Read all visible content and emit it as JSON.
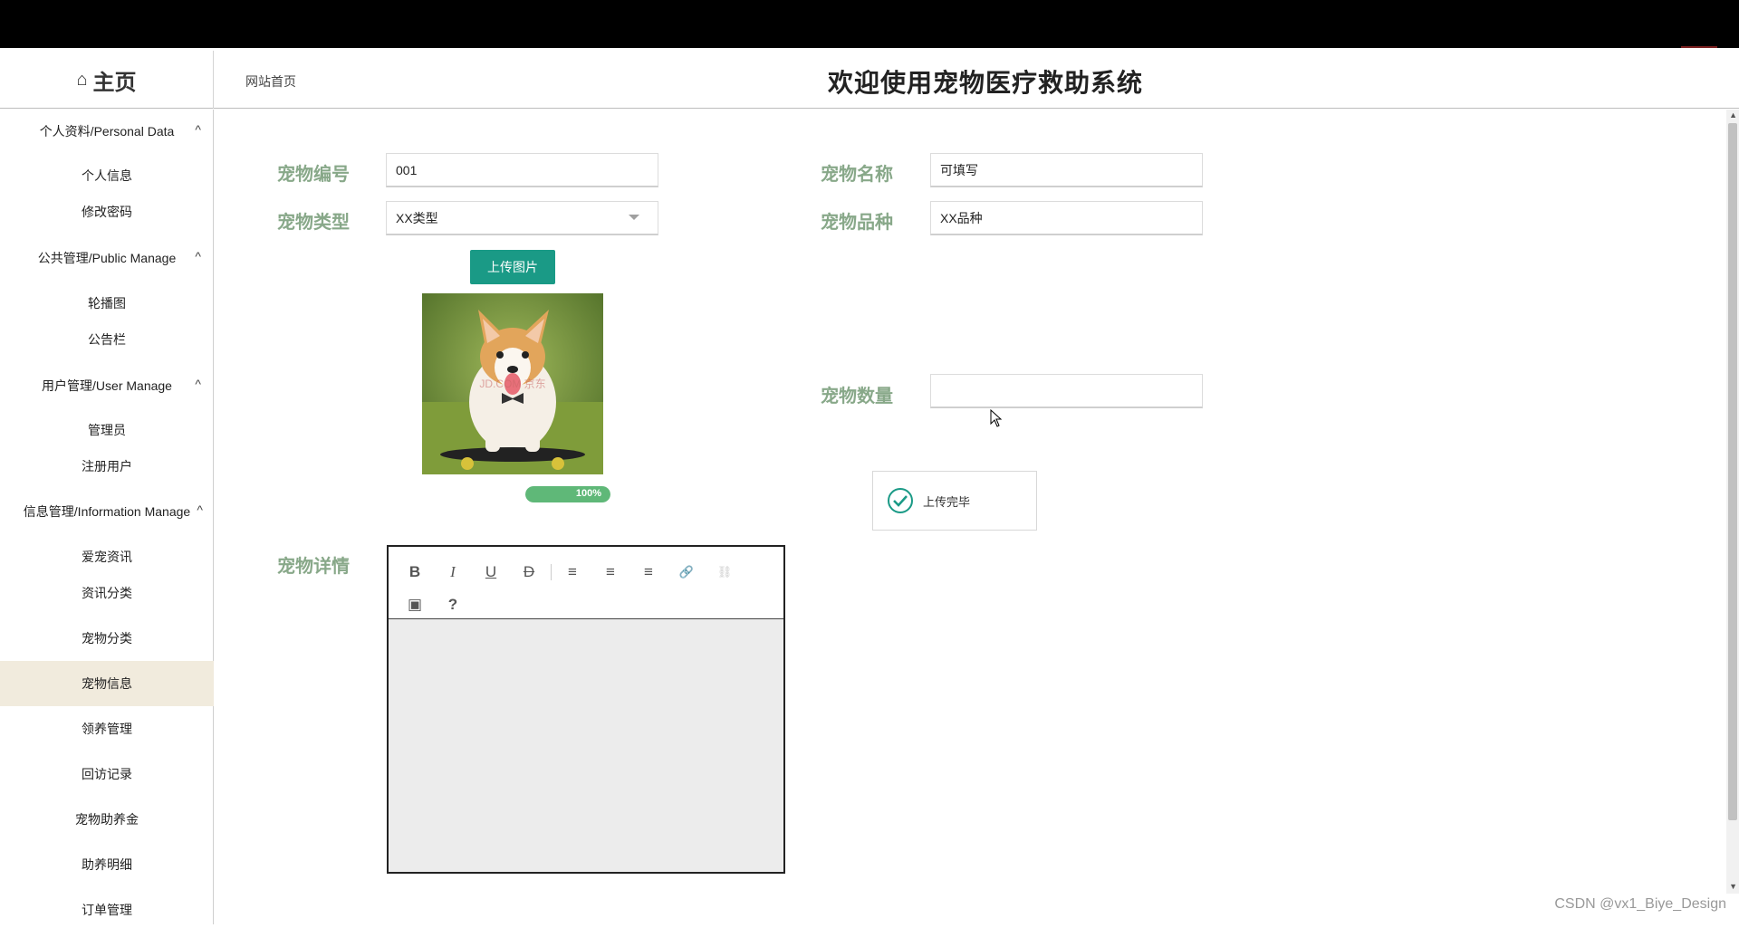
{
  "header": {
    "brand_icon": "⌂",
    "brand": "主页",
    "breadcrumb": "网站首页",
    "title": "欢迎使用宠物医疗救助系统"
  },
  "sidebar": {
    "groups": [
      {
        "label": "个人资料/Personal Data",
        "items": [
          "个人信息",
          "修改密码"
        ]
      },
      {
        "label": "公共管理/Public Manage",
        "items": [
          "轮播图",
          "公告栏"
        ]
      },
      {
        "label": "用户管理/User Manage",
        "items": [
          "管理员",
          "注册用户"
        ]
      },
      {
        "label": "信息管理/Information Manage",
        "items": [
          "爱宠资讯",
          "资讯分类",
          "宠物分类",
          "宠物信息",
          "领养管理",
          "回访记录",
          "宠物助养金",
          "助养明细",
          "订单管理"
        ]
      }
    ],
    "active_item": "宠物信息",
    "chevron": "^"
  },
  "form": {
    "pet_no_label": "宠物编号",
    "pet_no_value": "001",
    "pet_name_label": "宠物名称",
    "pet_name_value": "可填写",
    "pet_type_label": "宠物类型",
    "pet_type_value": "XX类型",
    "pet_breed_label": "宠物品种",
    "pet_breed_value": "XX品种",
    "upload_button": "上传图片",
    "photo_watermark": "JD.COM 京东",
    "upload_progress": 100,
    "upload_progress_label": "100%",
    "pet_count_label": "宠物数量",
    "pet_count_value": "",
    "pet_detail_label": "宠物详情"
  },
  "toast": {
    "message": "上传完毕",
    "icon": "check-circle-icon"
  },
  "editor": {
    "tools": [
      "B",
      "I",
      "U",
      "D",
      "|",
      "≡",
      "≡",
      "≡",
      "🔗",
      "⛓",
      "▣",
      "?"
    ]
  },
  "watermark": "CSDN @vx1_Biye_Design",
  "colors": {
    "label_green": "#88a889",
    "button_teal": "#1a9a86",
    "progress_green": "#5fb878",
    "active_item_bg": "#f1ebdd"
  }
}
